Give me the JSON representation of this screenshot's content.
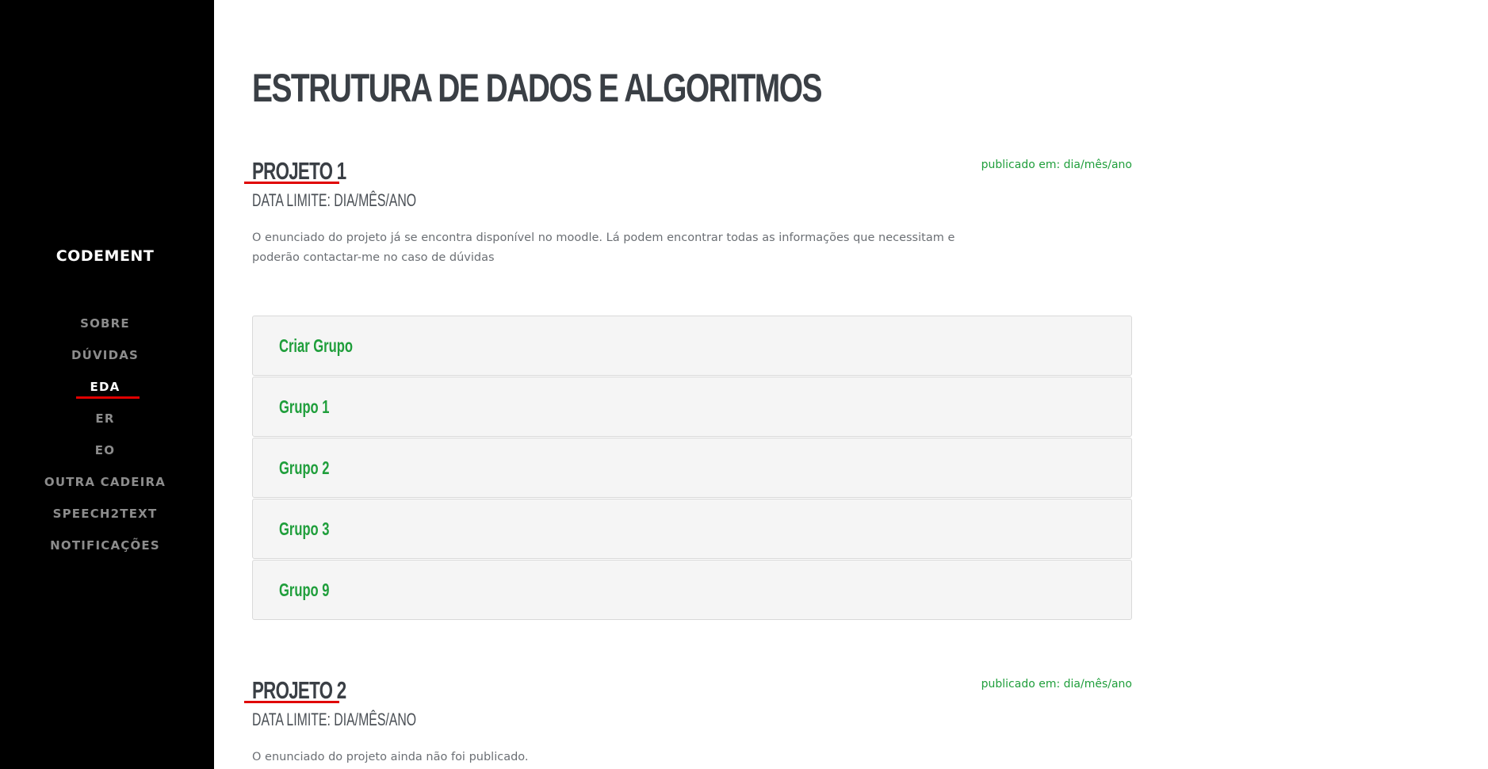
{
  "sidebar": {
    "brand": "CODEMENT",
    "items": [
      {
        "label": "SOBRE"
      },
      {
        "label": "DÚVIDAS"
      },
      {
        "label": "EDA"
      },
      {
        "label": "ER"
      },
      {
        "label": "EO"
      },
      {
        "label": "OUTRA CADEIRA"
      },
      {
        "label": "SPEECH2TEXT"
      },
      {
        "label": "NOTIFICAÇÕES"
      }
    ],
    "active_item": "EDA"
  },
  "main": {
    "title": "ESTRUTURA DE DADOS E ALGORITMOS",
    "projects": [
      {
        "title": "PROJETO 1",
        "deadline": "DATA LIMITE: DIA/MÊS/ANO",
        "published": "publicado em: dia/mês/ano",
        "description": "O enunciado do projeto já se encontra disponível no moodle. Lá podem encontrar todas as informações que necessitam e poderão contactar-me no caso de dúvidas",
        "groups": [
          {
            "label": "Criar Grupo"
          },
          {
            "label": "Grupo 1"
          },
          {
            "label": "Grupo 2"
          },
          {
            "label": "Grupo 3"
          },
          {
            "label": "Grupo 9"
          }
        ]
      },
      {
        "title": "PROJETO 2",
        "deadline": "DATA LIMITE: DIA/MÊS/ANO",
        "published": "publicado em: dia/mês/ano",
        "description": "O enunciado do projeto ainda não foi publicado."
      }
    ]
  },
  "colors": {
    "sidebar_bg": "#000000",
    "accent_red": "#e00000",
    "accent_green": "#1f9e3b",
    "heading": "#3a3f45"
  }
}
